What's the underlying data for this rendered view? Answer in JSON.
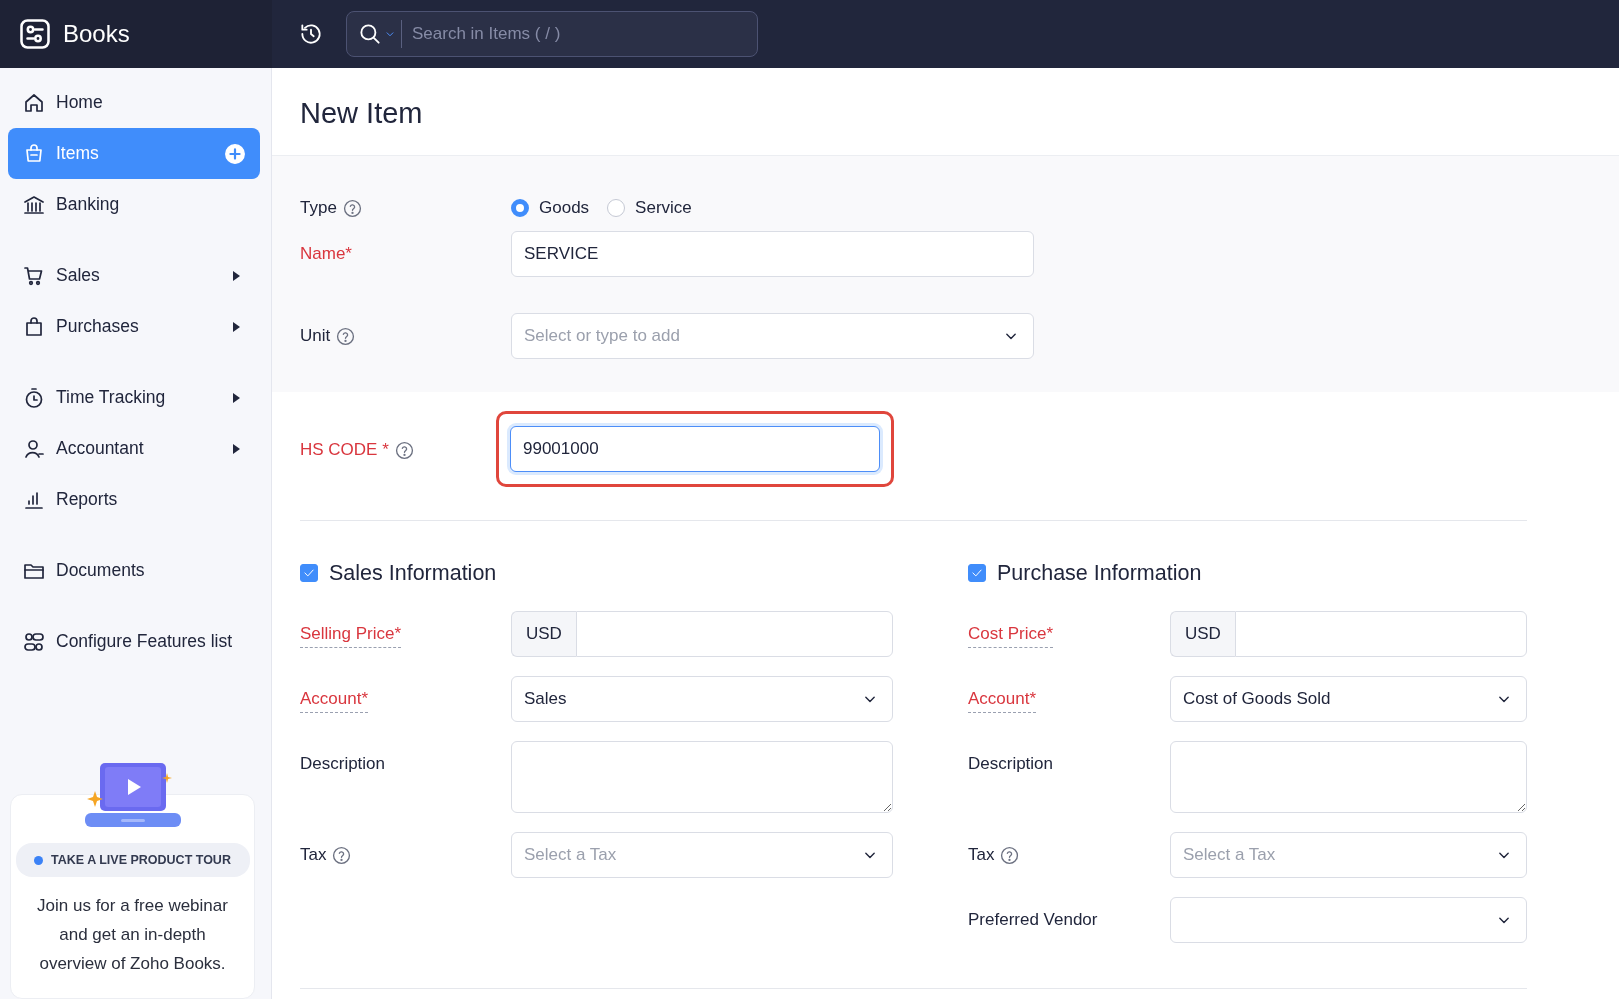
{
  "app": {
    "name": "Books"
  },
  "topbar": {
    "search_placeholder": "Search in Items ( / )"
  },
  "sidebar": {
    "groups": [
      {
        "items": [
          {
            "label": "Home",
            "selected": false,
            "expandable": false,
            "addable": false
          },
          {
            "label": "Items",
            "selected": true,
            "expandable": false,
            "addable": true
          },
          {
            "label": "Banking",
            "selected": false,
            "expandable": false,
            "addable": false
          }
        ]
      },
      {
        "items": [
          {
            "label": "Sales",
            "selected": false,
            "expandable": true,
            "addable": false
          },
          {
            "label": "Purchases",
            "selected": false,
            "expandable": true,
            "addable": false
          }
        ]
      },
      {
        "items": [
          {
            "label": "Time Tracking",
            "selected": false,
            "expandable": true,
            "addable": false
          },
          {
            "label": "Accountant",
            "selected": false,
            "expandable": true,
            "addable": false
          },
          {
            "label": "Reports",
            "selected": false,
            "expandable": false,
            "addable": false
          }
        ]
      },
      {
        "items": [
          {
            "label": "Documents",
            "selected": false,
            "expandable": false,
            "addable": false
          }
        ]
      },
      {
        "items": [
          {
            "label": "Configure Features list",
            "selected": false,
            "expandable": false,
            "addable": false
          }
        ]
      }
    ],
    "tour_card": {
      "badge": "TAKE A LIVE PRODUCT TOUR",
      "text": "Join us for a free webinar and get an in-depth overview of Zoho Books."
    }
  },
  "page": {
    "title": "New Item"
  },
  "form": {
    "type": {
      "label": "Type",
      "help": true,
      "options": [
        {
          "label": "Goods",
          "selected": true
        },
        {
          "label": "Service",
          "selected": false
        }
      ]
    },
    "name": {
      "label": "Name*",
      "required": true,
      "value": "SERVICE"
    },
    "unit": {
      "label": "Unit",
      "help": true,
      "placeholder": "Select or type to add"
    },
    "hs_code": {
      "label": "HS CODE *",
      "required": true,
      "help": true,
      "value": "99001000",
      "focused": true,
      "highlighted": true
    },
    "sections": [
      {
        "title": "Sales Information",
        "checked": true,
        "fields": [
          {
            "kind": "currency",
            "label": "Selling Price*",
            "required": true,
            "currency": "USD"
          },
          {
            "kind": "select",
            "label": "Account*",
            "required": true,
            "value": "Sales"
          },
          {
            "kind": "textarea",
            "label": "Description",
            "required": false
          },
          {
            "kind": "select",
            "label": "Tax",
            "required": false,
            "help": true,
            "placeholder": "Select a Tax"
          }
        ]
      },
      {
        "title": "Purchase Information",
        "checked": true,
        "fields": [
          {
            "kind": "currency",
            "label": "Cost Price*",
            "required": true,
            "currency": "USD"
          },
          {
            "kind": "select",
            "label": "Account*",
            "required": true,
            "value": "Cost of Goods Sold"
          },
          {
            "kind": "textarea",
            "label": "Description",
            "required": false
          },
          {
            "kind": "select",
            "label": "Tax",
            "required": false,
            "help": true,
            "placeholder": "Select a Tax"
          },
          {
            "kind": "select",
            "label": "Preferred Vendor",
            "required": false
          }
        ]
      }
    ]
  }
}
